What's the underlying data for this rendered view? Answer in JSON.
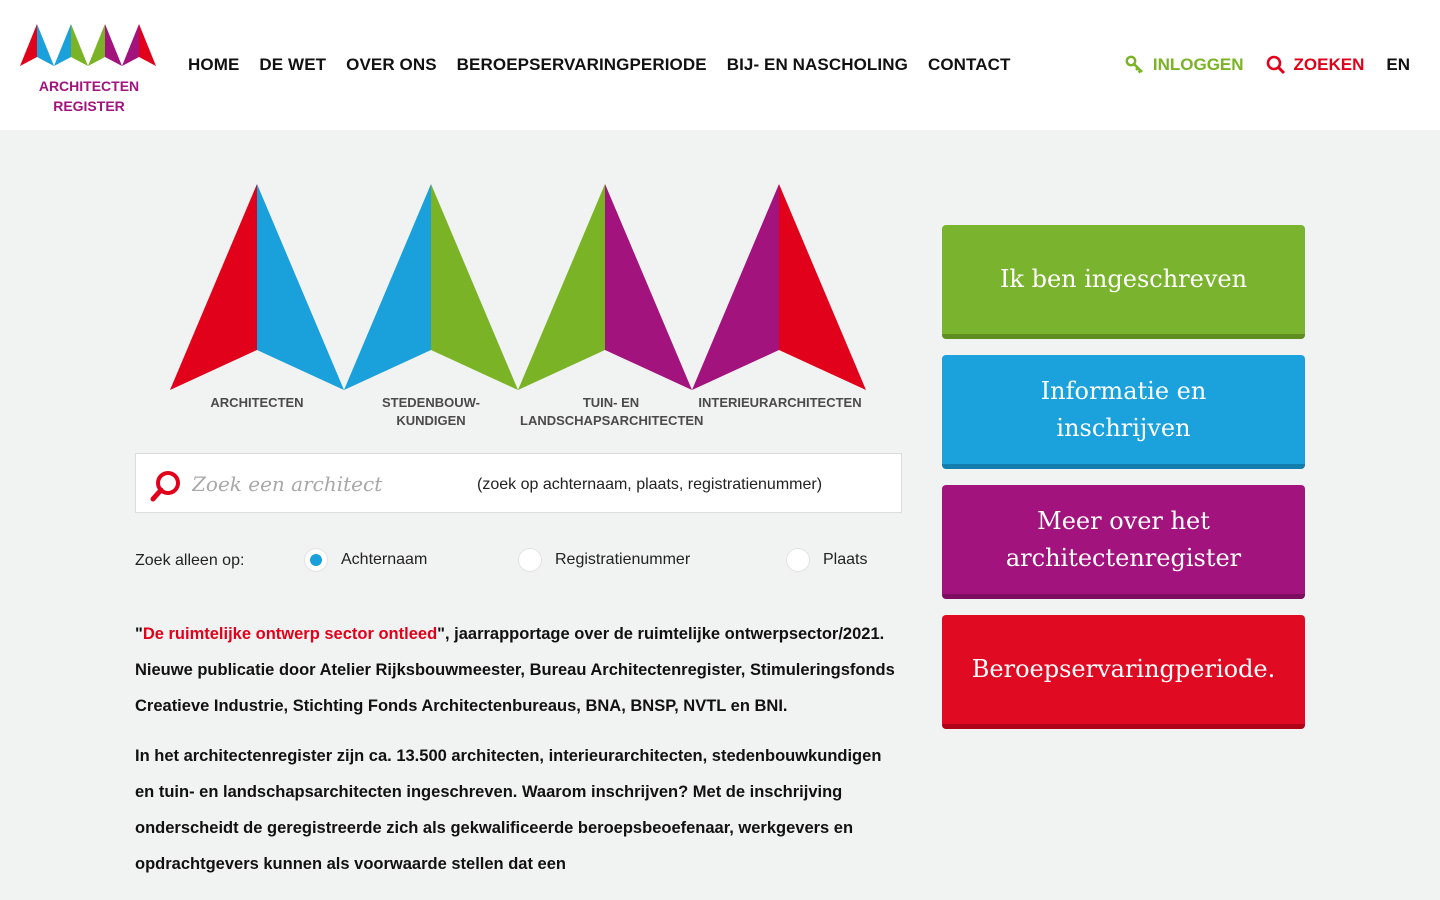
{
  "brand": {
    "logo_line1": "ARCHITECTEN",
    "logo_line2": "REGISTER"
  },
  "nav": {
    "items": [
      "HOME",
      "DE WET",
      "OVER ONS",
      "BEROEPSERVARINGPERIODE",
      "BIJ- EN NASCHOLING",
      "CONTACT"
    ],
    "login_label": "INLOGGEN",
    "search_label": "ZOEKEN",
    "lang_label": "EN"
  },
  "hero": {
    "categories": [
      {
        "line1": "ARCHITECTEN",
        "line2": ""
      },
      {
        "line1": "STEDENBOUW-",
        "line2": "KUNDIGEN"
      },
      {
        "line1": "TUIN- EN",
        "line2": "LANDSCHAPSARCHITECTEN"
      },
      {
        "line1": "INTERIEURARCHITECTEN",
        "line2": ""
      }
    ]
  },
  "search": {
    "placeholder": "Zoek een architect",
    "value": "",
    "hint": "(zoek op achternaam, plaats, registratienummer)"
  },
  "filter": {
    "lead": "Zoek alleen op:",
    "options": [
      {
        "label": "Achternaam",
        "selected": true
      },
      {
        "label": "Registratienummer",
        "selected": false
      },
      {
        "label": "Plaats",
        "selected": false
      }
    ]
  },
  "content": {
    "p1_open_quote": "\"",
    "p1_link": "De ruimtelijke ontwerp sector ontleed",
    "p1_rest": "\", jaarrapportage over de ruimtelijke ontwerpsector/2021. Nieuwe publicatie door Atelier Rijksbouwmeester, Bureau Architectenregister, Stimuleringsfonds Creatieve Industrie, Stichting Fonds Architectenbureaus, BNA, BNSP, NVTL en BNI.",
    "p2": "In het architectenregister zijn ca. 13.500 architecten, interieurarchitecten, stedenbouwkundigen en tuin- en landschapsarchitecten ingeschreven. Waarom inschrijven? Met de inschrijving onderscheidt de geregistreerde zich als gekwalificeerde beroepsbeoefenaar, werkgevers en opdrachtgevers kunnen als voorwaarde stellen dat een"
  },
  "cta": {
    "registered": "Ik ben ingeschreven",
    "info": "Informatie en inschrijven",
    "more": "Meer over het architectenregister",
    "period": "Beroepservaringperiode."
  },
  "colors": {
    "red": "#e1011b",
    "blue": "#1aa0db",
    "green": "#7ab325",
    "purple": "#a2137d"
  }
}
